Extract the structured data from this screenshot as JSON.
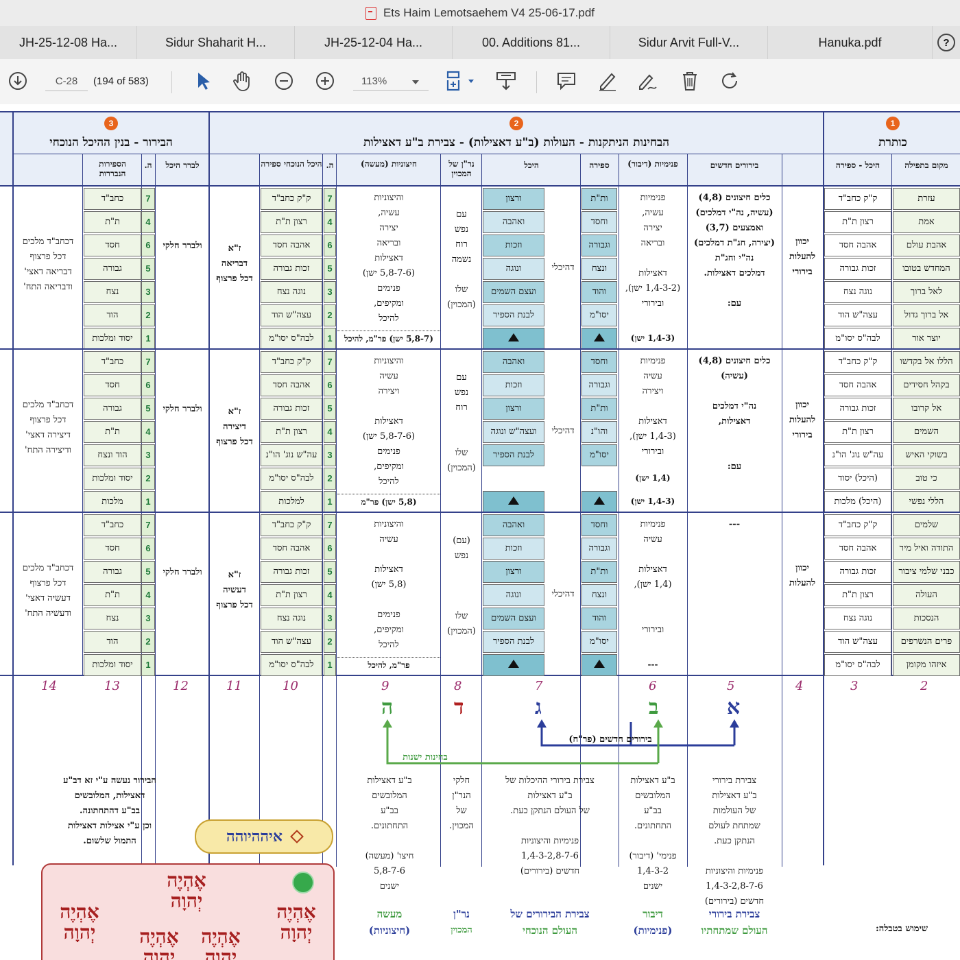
{
  "window": {
    "title": "Ets Haim Lemotsaehem V4 25-06-17.pdf"
  },
  "tabs": [
    {
      "label": "JH-25-12-08 Ha..."
    },
    {
      "label": "Sidur Shaharit H..."
    },
    {
      "label": "JH-25-12-04 Ha..."
    },
    {
      "label": "00. Additions 81..."
    },
    {
      "label": "Sidur Arvit Full-V..."
    },
    {
      "label": "Hanuka.pdf"
    }
  ],
  "toolbar": {
    "page_label": "C-28",
    "page_count": "(194 of 583)",
    "zoom": "113%",
    "icons": [
      "download-icon",
      "pointer-icon",
      "hand-icon",
      "zoom-out-icon",
      "zoom-in-icon",
      "select-crop-icon",
      "stamp-icon",
      "comment-icon",
      "pen-icon",
      "sign-icon",
      "trash-icon",
      "rotate-icon"
    ]
  },
  "document": {
    "sections": {
      "s1": {
        "num": "1",
        "title": "כותרת"
      },
      "s2": {
        "num": "2",
        "title": "הבחינות הניתקנות - העולות (ב\"ע דאצילות) - צבירת ב\"ע דאצילות"
      },
      "s3": {
        "num": "3",
        "title": "הבירור - בנין ההיכל הנוכחי"
      }
    },
    "col_headers": {
      "makom": "מקום בתפילה",
      "heichal_sefira": "היכל - ספירה",
      "birurim": "בירורים חדשים",
      "pnimiut": "פנימיות (דיבור)",
      "sefira": "ספירה",
      "heichal": "היכל",
      "nrn": "נר\"ן של המכוין",
      "chitzoniut": "חיצוניות (מעשה)",
      "h": "ה.",
      "heichal_nochechi": "היכל הנוכחי ספירה",
      "levarer": "לברר היכל",
      "sefirot_nivrarot": "הספירות הנבררות"
    },
    "band1": {
      "makom": [
        "עזרת",
        "אמת",
        "אהבת עולם",
        "המחדש בטובו",
        "לאל ברוך",
        "אל ברוך גדול",
        "יוצר אור"
      ],
      "heichal_sefira": [
        "ק\"ק כחב\"ד",
        "רצון ת\"ת",
        "אהבה חסד",
        "זכות גבורה",
        "נוגה נצח",
        "עצה\"ש הוד",
        "לבה\"ס יסו\"מ"
      ],
      "kavana": "יכוון להעלות בירורי",
      "birurim": "כלים חיצונים (4,8)\n(עשיה, נה\"י דמלכים)\nואמצעים (3,7)\n(יצירה, חג\"ת דמלכים)\nנה\"י וחג\"ת\nדמלכים דאצילות.\n\nעם:",
      "pnimiut": "פנימיות\nעשיה,\nיצירה\nובריאה\n\nדאצילות\n(1,4-3-2 ישן),\nובירורי",
      "pnimiut_last": "(1,4-3 ישן)",
      "sefira": [
        "ות\"ת",
        "וחסד",
        "וגבורה",
        "ונצח",
        "והוד",
        "יסו\"מ"
      ],
      "heichal": [
        "ורצון",
        "ואהבה",
        "וזכות",
        "ונוגה",
        "ועצם השמים",
        "לבנת הספיר"
      ],
      "heichal_label": "דהיכלי",
      "nrn": "עם\nנפש\nרוח\nנשמה\n\nשלו\n(המכוין)",
      "chitzoniut": "והיצוניות\nעשיה,\nיצירה\nובריאה\nדאצילות\n(5,8-7-6 ישן)\nפנימים\nומקיפים,\nלהיכל",
      "chitzoniut_last": "(5,8-7 ישן) פר\"מ, להיכל",
      "heichal_nochechi": [
        "ק\"ק כחב\"ד",
        "רצון ת\"ת",
        "אהבה חסד",
        "זכות גבורה",
        "נוגה נצח",
        "עצה\"ש הוד",
        "לבה\"ס יסו\"מ"
      ],
      "h_nums": [
        "7",
        "4",
        "6",
        "5",
        "3",
        "2",
        "1"
      ],
      "ze": "ז\"א\nדבריאה\nדכל פרצוף",
      "levarer": "ולברר חלקי",
      "sefirot": [
        "כחב\"ד",
        "ת\"ת",
        "חסד",
        "גבורה",
        "נצח",
        "הוד",
        "יסוד ומלכות"
      ],
      "sefirot_nums": [
        "7",
        "4",
        "6",
        "5",
        "3",
        "2",
        "1"
      ],
      "last": "דכחב\"ד מלכים\nדכל פרצוף\nדבריאה דאצי'\nודבריאה התח'"
    },
    "band2": {
      "makom": [
        "הללו אל בקדשו",
        "בקהל חסידים",
        "אל קרובו",
        "השמים",
        "בשוקי האיש",
        "כי טוב",
        "הללי נפשי"
      ],
      "heichal_sefira": [
        "ק\"ק כחב\"ד",
        "אהבה חסד",
        "זכות גבורה",
        "רצון ת\"ת",
        "עה\"ש נוג' הו\"נ",
        "(היכל) יסוד",
        "(היכל) מלכות"
      ],
      "kavana": "יכוון להעלות בירורי",
      "birurim": "כלים חיצונים (4,8)\n(עשיה)\n\nנה\"י דמלכים\nדאצילות,\n\n\nעם:",
      "pnimiut": "פנימיות\nעשיה\nויצירה\n\nדאצילות\n(1,4-3 ישן),\nובירורי",
      "pnimiut_last": "(1,4-3 ישן)",
      "pnimiut_last2": "(1,4 ישן)",
      "sefira": [
        "וחסד",
        "וגבורה",
        "ות\"ת",
        "והו\"נ",
        "יסו\"מ"
      ],
      "heichal": [
        "ואהבה",
        "וזכות",
        "ורצון",
        "ועצה\"ש ונוגה",
        "לבנת הספיר"
      ],
      "heichal_label": "דהיכלי",
      "nrn": "עם\nנפש\nרוח\n\n\nשלו\n(המכוין)",
      "chitzoniut": "והיצוניות\nעשיה\nויצירה\n\nדאצילות\n(5,8-7-6 ישן)\nפנימים\nומקיפים,\nלהיכל",
      "chitzoniut_last": "(5,8 ישן) פר\"מ",
      "heichal_nochechi": [
        "ק\"ק כחב\"ד",
        "אהבה חסד",
        "זכות גבורה",
        "רצון ת\"ת",
        "עה\"ש נוג' הו\"נ",
        "לבה\"ס יסו\"מ",
        "למלכות"
      ],
      "h_nums": [
        "7",
        "6",
        "5",
        "4",
        "3",
        "2",
        "1"
      ],
      "ze": "ז\"א\nדיצירה\nדכל פרצוף",
      "levarer": "ולברר חלקי",
      "sefirot": [
        "כחב\"ד",
        "חסד",
        "גבורה",
        "ת\"ת",
        "הוד ונצח",
        "יסוד ומלכות",
        "מלכות"
      ],
      "sefirot_nums": [
        "7",
        "6",
        "5",
        "4",
        "3",
        "2",
        "1"
      ],
      "last": "דכחב\"ד מלכים\nדכל פרצוף\nדיצירה דאצי'\nודיצירה התח'"
    },
    "band3": {
      "makom": [
        "שלמים",
        "התודה ואיל מיר",
        "כבני שלמי ציבור",
        "העולה",
        "הנסכות",
        "פרים הנשרפים",
        "איזהו מקומן"
      ],
      "heichal_sefira": [
        "ק\"ק כחב\"ד",
        "אהבה חסד",
        "זכות גבורה",
        "רצון ת\"ת",
        "נוגה נצח",
        "עצה\"ש הוד",
        "לבה\"ס יסו\"מ"
      ],
      "kavana": "יכוון להעלות",
      "birurim": "---",
      "pnimiut": "פנימיות\nעשיה\n\nדאצילות\n(1,4 ישן),\n\n\nובירורי",
      "pnimiut_last": "---",
      "sefira": [
        "וחסד",
        "וגבורה",
        "ות\"ת",
        "ונצח",
        "והוד",
        "יסו\"מ"
      ],
      "heichal": [
        "ואהבה",
        "וזכות",
        "ורצון",
        "ונוגה",
        "ועצם השמים",
        "לבנת הספיר"
      ],
      "heichal_label": "דהיכלי",
      "nrn": "(עם)\nנפש\n\n\n\nשלו\n(המכוין)",
      "chitzoniut": "והיצוניות\nעשיה\n\nדאצילות\n(5,8 ישן)\n\nפנימים\nומקיפים,\nלהיכל",
      "chitzoniut_last": "פר\"מ, להיכל",
      "heichal_nochechi": [
        "ק\"ק כחב\"ד",
        "אהבה חסד",
        "זכות גבורה",
        "רצון ת\"ת",
        "נוגה נצח",
        "עצה\"ש הוד",
        "לבה\"ס יסו\"מ"
      ],
      "h_nums": [
        "7",
        "6",
        "5",
        "4",
        "3",
        "2",
        "1"
      ],
      "ze": "ז\"א\nדעשיה\nדכל פרצוף",
      "levarer": "ולברר חלקי",
      "sefirot": [
        "כחב\"ד",
        "חסד",
        "גבורה",
        "ת\"ת",
        "נצח",
        "הוד",
        "יסוד ומלכות"
      ],
      "sefirot_nums": [
        "7",
        "6",
        "5",
        "4",
        "3",
        "2",
        "1"
      ],
      "last": "דכחב\"ד מלכים\nדכל פרצוף\nדעשיה דאצי'\nודעשיה התח'"
    },
    "col_numbers": [
      "14",
      "13",
      "12",
      "11",
      "10",
      "9",
      "8",
      "7",
      "6",
      "5",
      "4",
      "3",
      "2"
    ],
    "letters": {
      "c9": "ה",
      "c8": "ד",
      "c7": "ג",
      "c6": "ב",
      "c5": "א"
    },
    "letter_colors": {
      "c9": "#3f9a3f",
      "c8": "#b02020",
      "c7": "#2b3d9a",
      "c6": "#3f9a3f",
      "c5": "#2b3d9a"
    },
    "arrow_labels": {
      "blue": "בירורים חדשים (פר\"ח)",
      "green": "בחינות ישנות"
    },
    "bottom": {
      "birur_note": "הבירור נעשה ע\"י זא דב\"ע\nדאצילות, המלובשים\nבב\"ע דהתחתונה.\nוכן ע\"י אצילות דאצילות\nהתמול שלשום.",
      "pill": "איההיוהה",
      "c9": "ב\"ע דאצילות\nהמלובשים\nבב\"ע\nהתחתונים.\n\nחיצו' (מעשה)\n5,8-7-6\nישנים",
      "c9_green": "מעשה",
      "c9_blue": "(חיצוניות)",
      "c8": "חלקי\nהנר\"ן\nשל\nהמכוין.",
      "c8_green": "נר\"ן",
      "c8_blue": "המכוין",
      "c7": "צבירת בירורי ההיכלות של\nב\"ע דאצילות\nשל העולם הנתקן כעת.\n\nפנימיות והיצוניות\n1,4-3-2,8-7-6\nחדשים (בירורים)",
      "c7_blue": "צבירת הבירורים של",
      "c7_green": "העולם הנוכחי",
      "c6": "ב\"ע דאצילות\nהמלובשים\nבב\"ע\nהתחתונים.\n\nפנימי' (דיבור)\n1,4-3-2\nישנים",
      "c6_green": "דיבור",
      "c6_blue": "(פנימיות)",
      "c5": "צבירת בירורי\nב\"ע דאצילות\nשל העולמות\nשמתחת לעולם\nהנתקן כעת.\n\nפנימיות והיצוניות\n1,4-3-2,8-7-6\nחדשים (בירורים)",
      "c5_blue": "צבירת בירורי",
      "c5_green": "העולם שמתחתיו",
      "red_right": "אֶהְיֶה\nיְהוָה",
      "red_center_top": "אֶהְיֶה\nיְהוָה",
      "red_left": "אֶהְיֶה\nיְהוָה",
      "red_mid1": "אֶהְיֶה\nיְהוָה",
      "red_mid2": "אֶהְיֶה\nיְהוָה",
      "footer_note": "שימוש בטבלה:"
    }
  },
  "colors": {
    "frame": "#34418a",
    "accent": "#e8641c",
    "green": "#3f9a3f",
    "blue": "#2b3d9a"
  }
}
